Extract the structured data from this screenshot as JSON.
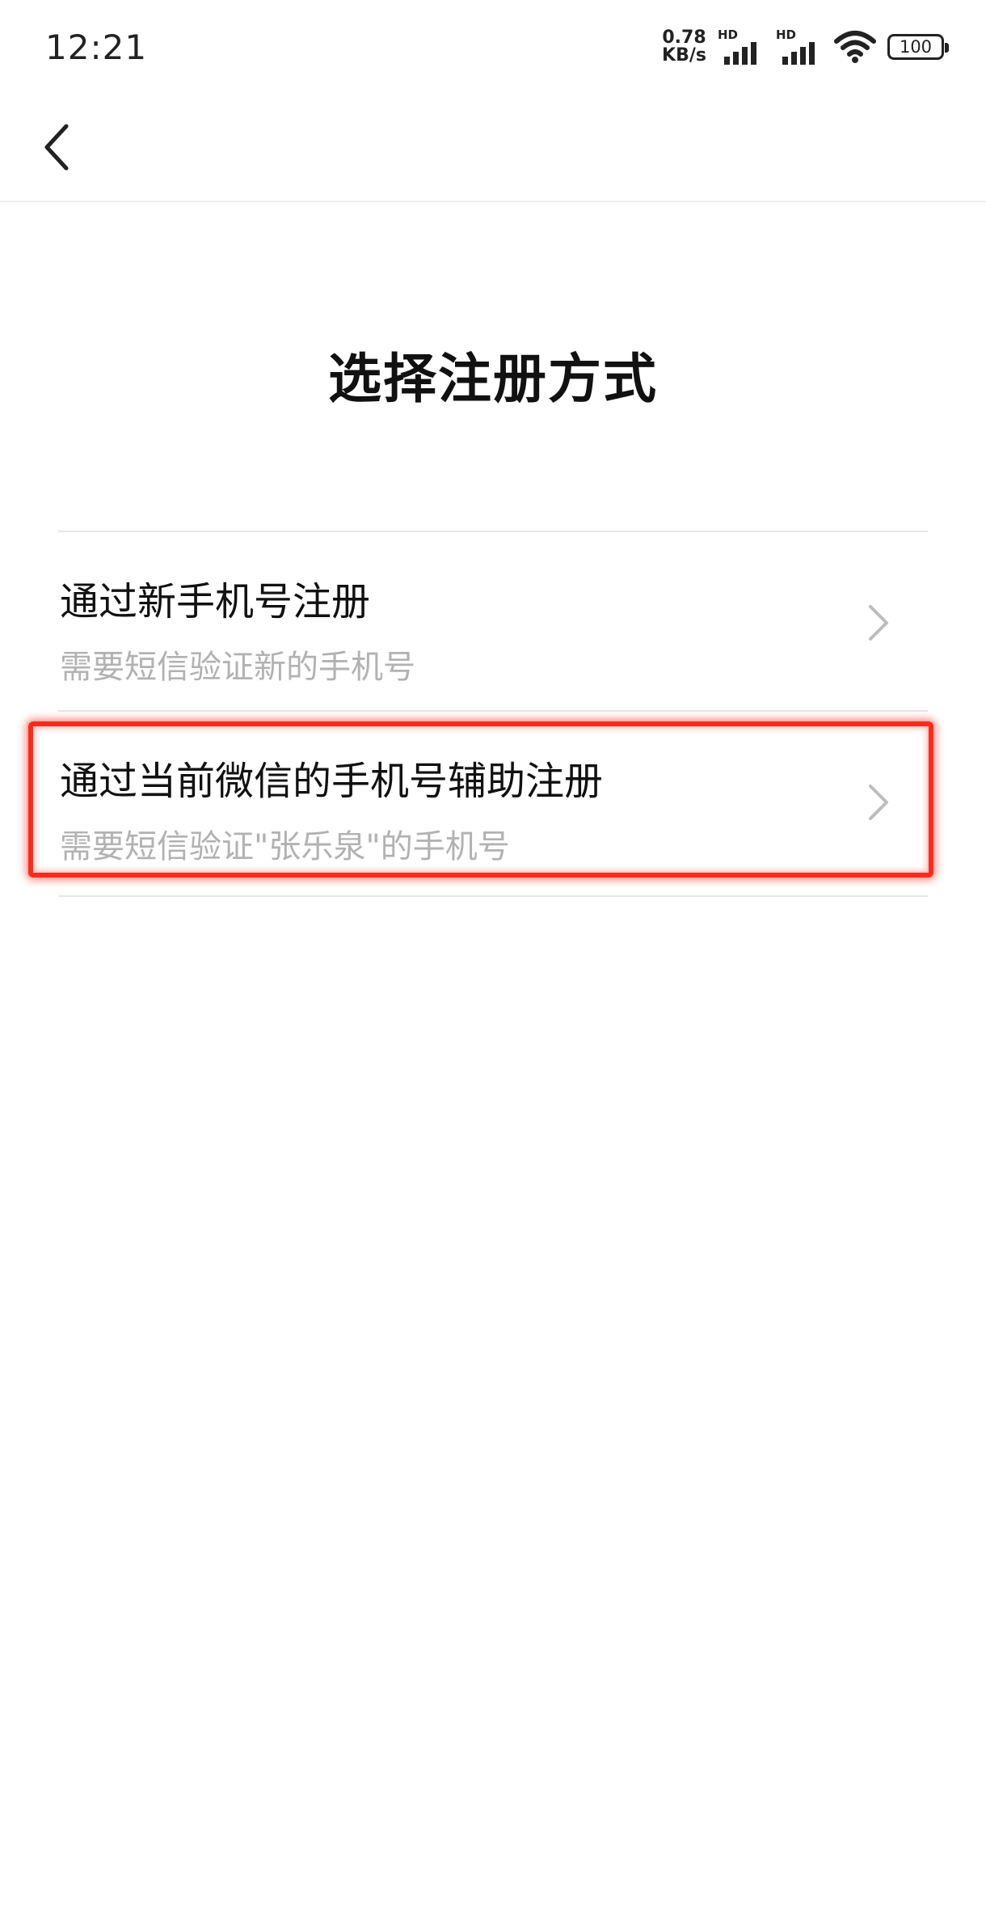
{
  "status_bar": {
    "time": "12:21",
    "net_speed_value": "0.78",
    "net_speed_unit": "KB/s",
    "sim1_label": "HD",
    "sim2_label": "HD",
    "battery": "100"
  },
  "nav": {
    "back_icon": "chevron-left-icon"
  },
  "page": {
    "title": "选择注册方式"
  },
  "options": [
    {
      "title": "通过新手机号注册",
      "description": "需要短信验证新的手机号",
      "icon": "chevron-right-icon"
    },
    {
      "title": "通过当前微信的手机号辅助注册",
      "description": "需要短信验证\"张乐泉\"的手机号",
      "icon": "chevron-right-icon"
    }
  ],
  "colors": {
    "highlight": "#ff2a1a",
    "description_text": "#b2b2b2",
    "divider": "#e6e6e6"
  }
}
